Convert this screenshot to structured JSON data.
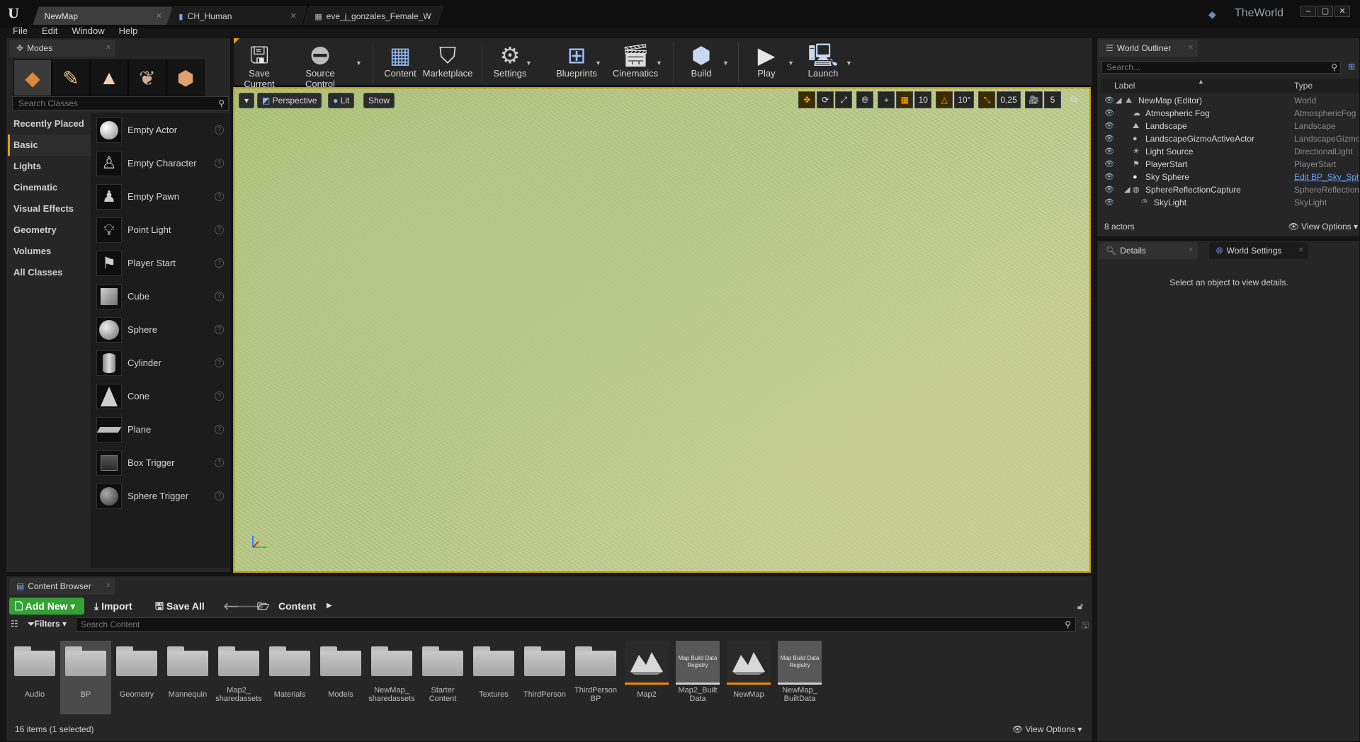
{
  "window": {
    "tabs": [
      {
        "label": "NewMap"
      },
      {
        "label": "CH_Human"
      },
      {
        "label": "eve_j_gonzales_Female_W"
      }
    ],
    "project_name": "TheWorld",
    "logo": "U"
  },
  "menu": [
    "File",
    "Edit",
    "Window",
    "Help"
  ],
  "modes": {
    "tab_label": "Modes",
    "search_placeholder": "Search Classes",
    "categories": [
      "Recently Placed",
      "Basic",
      "Lights",
      "Cinematic",
      "Visual Effects",
      "Geometry",
      "Volumes",
      "All Classes"
    ],
    "selected_category": "Basic",
    "items": [
      "Empty Actor",
      "Empty Character",
      "Empty Pawn",
      "Point Light",
      "Player Start",
      "Cube",
      "Sphere",
      "Cylinder",
      "Cone",
      "Plane",
      "Box Trigger",
      "Sphere Trigger"
    ]
  },
  "toolbar": {
    "buttons": [
      "Save Current",
      "Source Control",
      "Content",
      "Marketplace",
      "Settings",
      "Blueprints",
      "Cinematics",
      "Build",
      "Play",
      "Launch"
    ]
  },
  "viewport": {
    "view_mode": "Perspective",
    "lighting": "Lit",
    "show": "Show",
    "grid_snap": "10",
    "rotation_snap": "10°",
    "scale_snap": "0,25",
    "camera_speed": "5"
  },
  "outliner": {
    "tab_label": "World Outliner",
    "search_placeholder": "Search...",
    "col_label": "Label",
    "col_type": "Type",
    "rows": [
      {
        "label": "NewMap (Editor)",
        "type": "World"
      },
      {
        "label": "Atmospheric Fog",
        "type": "AtmosphericFog"
      },
      {
        "label": "Landscape",
        "type": "Landscape"
      },
      {
        "label": "LandscapeGizmoActiveActor",
        "type": "LandscapeGizmoA"
      },
      {
        "label": "Light Source",
        "type": "DirectionalLight"
      },
      {
        "label": "PlayerStart",
        "type": "PlayerStart"
      },
      {
        "label": "Sky Sphere",
        "type": "Edit BP_Sky_Sphe"
      },
      {
        "label": "SphereReflectionCapture",
        "type": "SphereReflectionC"
      },
      {
        "label": "SkyLight",
        "type": "SkyLight"
      }
    ],
    "actor_count": "8 actors",
    "view_options": "View Options"
  },
  "details": {
    "tab_label": "Details",
    "world_settings_label": "World Settings",
    "empty_message": "Select an object to view details."
  },
  "content_browser": {
    "tab_label": "Content Browser",
    "add_new": "Add New",
    "import": "Import",
    "save_all": "Save All",
    "path": "Content",
    "filters": "Filters",
    "search_placeholder": "Search Content",
    "assets": [
      {
        "name": "Audio",
        "kind": "folder"
      },
      {
        "name": "BP",
        "kind": "folder"
      },
      {
        "name": "Geometry",
        "kind": "folder"
      },
      {
        "name": "Mannequin",
        "kind": "folder"
      },
      {
        "name": "Map2_ sharedassets",
        "kind": "folder"
      },
      {
        "name": "Materials",
        "kind": "folder"
      },
      {
        "name": "Models",
        "kind": "folder"
      },
      {
        "name": "NewMap_ sharedassets",
        "kind": "folder"
      },
      {
        "name": "Starter Content",
        "kind": "folder"
      },
      {
        "name": "Textures",
        "kind": "folder"
      },
      {
        "name": "ThirdPerson",
        "kind": "folder"
      },
      {
        "name": "ThirdPerson BP",
        "kind": "folder"
      },
      {
        "name": "Map2",
        "kind": "map"
      },
      {
        "name": "Map2_Built Data",
        "kind": "registry"
      },
      {
        "name": "NewMap",
        "kind": "map"
      },
      {
        "name": "NewMap_ BuiltData",
        "kind": "registry"
      }
    ],
    "registry_thumb_text": "Map Build Data Registry",
    "selected_asset": "BP",
    "status": "16 items (1 selected)",
    "view_options": "View Options"
  }
}
